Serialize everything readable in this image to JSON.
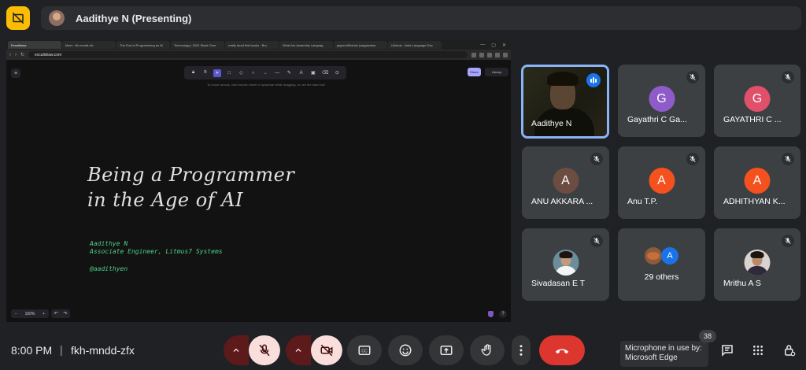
{
  "presenter": {
    "title": "Aadithye N (Presenting)"
  },
  "browser": {
    "tabs": [
      "Excalidraw",
      "Meet - fkh-mndd-zfx",
      "The End of Programming as W",
      "Technology | 2024 Stack Over",
      "crafty head first books - Bro",
      "What Are Assembly Languag",
      "jaypem/Mctrols (aayyarakar",
      "Ukiredo - Italic Language Doc"
    ],
    "url": "excalidraw.com"
  },
  "excalidraw": {
    "hint": "To move canvas, hold mouse wheel or spacebar while dragging, or use the hand tool",
    "share_label": "Share",
    "library_label": "Library",
    "zoom_label": "100%",
    "slide": {
      "title_line1": "Being a Programmer",
      "title_line2": "in the Age of AI",
      "author": "Aadithye N",
      "role": "Associate Engineer, Litmus7 Systems",
      "handle": "@aadithyen"
    }
  },
  "participants": [
    {
      "name": "Aadithye N",
      "initial": "",
      "color": ""
    },
    {
      "name": "Gayathri C Ga...",
      "initial": "G",
      "color": "#8e5bc8"
    },
    {
      "name": "GAYATHRI C ...",
      "initial": "G",
      "color": "#e0506a"
    },
    {
      "name": "ANU AKKARA ...",
      "initial": "A",
      "color": "#6d4c41"
    },
    {
      "name": "Anu T.P.",
      "initial": "A",
      "color": "#f4511e"
    },
    {
      "name": "ADHITHYAN K...",
      "initial": "A",
      "color": "#f4511e"
    },
    {
      "name": "Sivadasan E T",
      "initial": "",
      "color": ""
    },
    {
      "name": "29 others",
      "initial": "A",
      "color": "#1a73e8"
    },
    {
      "name": "Mrithu A S",
      "initial": "",
      "color": ""
    }
  ],
  "meeting": {
    "time": "8:00 PM",
    "separator": "|",
    "code": "fkh-mndd-zfx",
    "mic_tooltip_line1": "Microphone in use by:",
    "mic_tooltip_line2": "Microsoft Edge",
    "participant_count": "38"
  }
}
